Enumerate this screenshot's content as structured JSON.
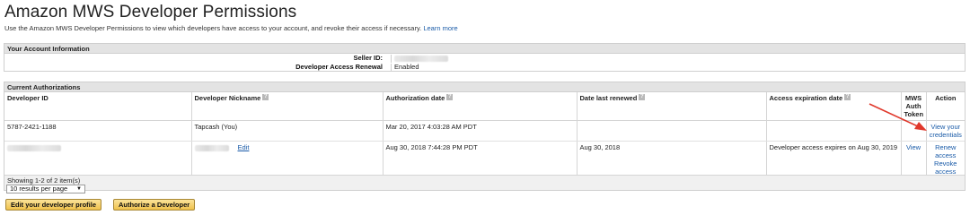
{
  "page": {
    "title": "Amazon MWS Developer Permissions",
    "intro_text": "Use the Amazon MWS Developer Permissions to view which developers have access to your account, and revoke their access if necessary.",
    "learn_more": "Learn more"
  },
  "account": {
    "header": "Your Account Information",
    "seller_id_label": "Seller ID:",
    "renewal_label": "Developer Access Renewal",
    "renewal_value": "Enabled"
  },
  "authorizations": {
    "header": "Current Authorizations",
    "columns": {
      "developer_id": "Developer ID",
      "nickname": "Developer Nickname",
      "auth_date": "Authorization date",
      "last_renewed": "Date last renewed",
      "expiration": "Access expiration date",
      "mws_token": "MWS Auth Token",
      "action": "Action"
    },
    "help_glyph": "?",
    "rows": [
      {
        "developer_id": "5787-2421-1188",
        "nickname": "Tapcash (You)",
        "auth_date": "Mar 20, 2017 4:03:28 AM PDT",
        "last_renewed": "",
        "expiration": "",
        "mws_token": "",
        "action": "View your credentials"
      },
      {
        "nickname_edit": "Edit",
        "auth_date": "Aug 30, 2018 7:44:28 PM PDT",
        "last_renewed": "Aug 30, 2018",
        "expiration": "Developer access expires on  Aug 30, 2019",
        "mws_token": "View",
        "action_renew": "Renew access",
        "action_revoke": "Revoke access"
      }
    ],
    "showing": "Showing 1-2 of 2 item(s)",
    "per_page": "10 results per page"
  },
  "buttons": {
    "edit_profile": "Edit your developer profile",
    "authorize": "Authorize a Developer"
  },
  "colors": {
    "link": "#1a5ba8",
    "button": "#f0c14b",
    "arrow": "#e0382b"
  }
}
